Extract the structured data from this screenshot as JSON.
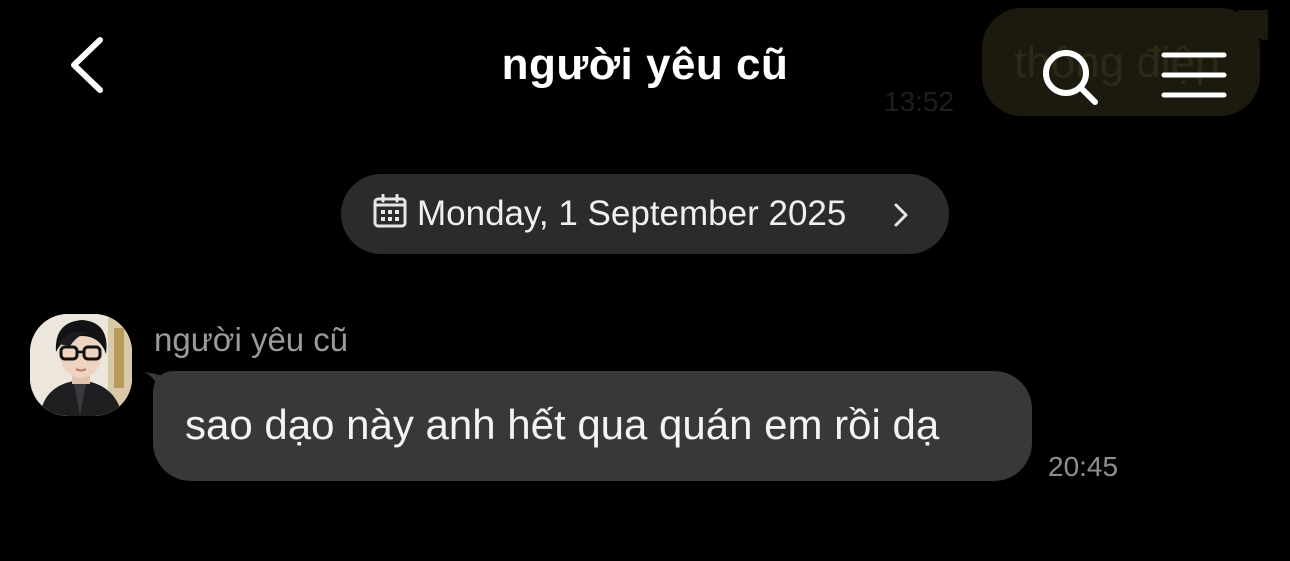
{
  "header": {
    "title": "người yêu cũ",
    "back_icon": "chevron-left-icon",
    "search_icon": "search-icon",
    "menu_icon": "menu-icon"
  },
  "previous_message": {
    "text": "thông điệp",
    "time": "13:52"
  },
  "date_divider": {
    "icon": "calendar-icon",
    "label": "Monday, 1 September 2025",
    "chevron": "chevron-right-icon"
  },
  "messages": [
    {
      "sender": "người yêu cũ",
      "text": "sao dạo này anh hết qua quán em rồi dạ",
      "time": "20:45"
    }
  ],
  "colors": {
    "background": "#000000",
    "incoming_bubble": "#38383a",
    "date_pill": "#2b2b2d",
    "secondary_text": "#8e8e93"
  }
}
